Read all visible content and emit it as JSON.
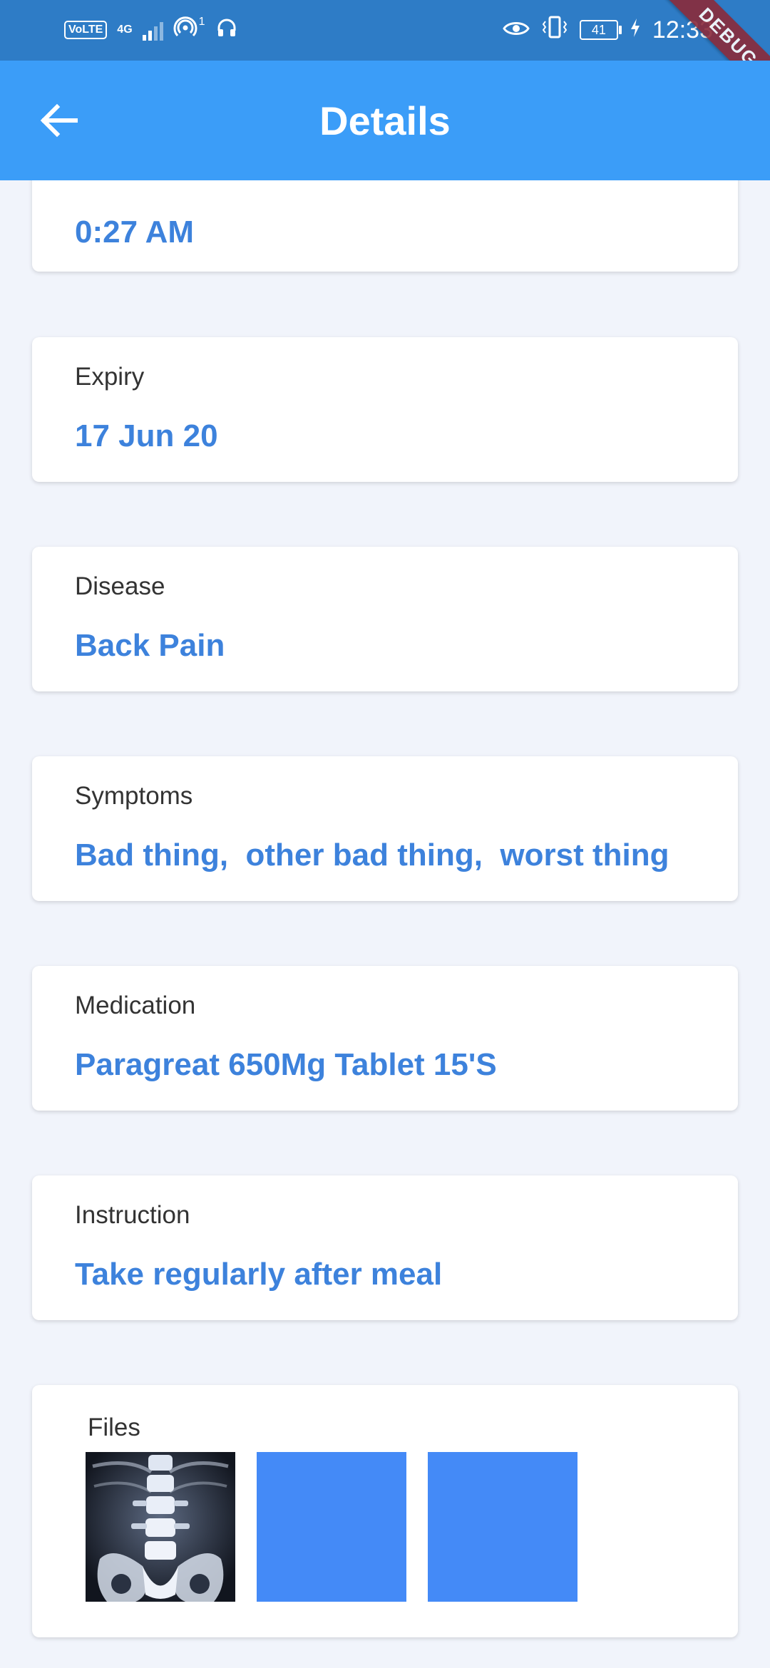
{
  "status_bar": {
    "volte": "VoLTE",
    "network": "4G",
    "sim_slot": "1",
    "battery": "41",
    "time": "12:33"
  },
  "debug_banner": "DEBUG",
  "app_bar": {
    "title": "Details"
  },
  "cards": {
    "time": {
      "value": "0:27 AM"
    },
    "expiry": {
      "label": "Expiry",
      "value": "17 Jun 20"
    },
    "disease": {
      "label": "Disease",
      "value": "Back Pain"
    },
    "symptoms": {
      "label": "Symptoms",
      "value": "Bad thing,  other bad thing,  worst thing"
    },
    "medication": {
      "label": "Medication",
      "value": "Paragreat 650Mg Tablet 15'S"
    },
    "instruction": {
      "label": "Instruction",
      "value": "Take regularly after meal"
    }
  },
  "files": {
    "label": "Files",
    "items": [
      "xray-image",
      "blue-placeholder",
      "blue-placeholder"
    ]
  },
  "colors": {
    "status_bar": "#2e7cc6",
    "app_bar": "#3b9df8",
    "value_text": "#3d82dc",
    "placeholder": "#448af7",
    "background": "#f1f4fb",
    "debug": "#8a2a3a"
  }
}
